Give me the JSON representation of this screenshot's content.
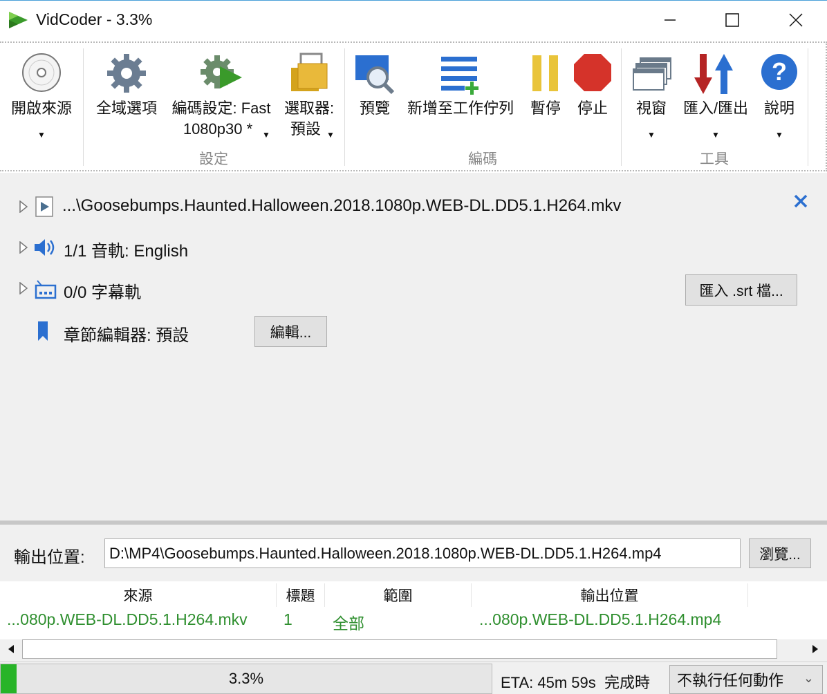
{
  "window": {
    "title": "VidCoder - 3.3%",
    "minimize_glyph": "—",
    "maximize_glyph": "☐",
    "close_glyph": "✕"
  },
  "ribbon": {
    "open_source": "開啟來源",
    "global_options": "全域選項",
    "encoding_settings_line1": "編碼設定: Fast",
    "encoding_settings_line2": "1080p30 *",
    "picker_line1": "選取器:",
    "picker_line2": "預設",
    "preview": "預覽",
    "add_to_queue": "新增至工作佇列",
    "pause": "暫停",
    "stop": "停止",
    "window_menu": "視窗",
    "import_export": "匯入/匯出",
    "help": "說明",
    "group_settings": "設定",
    "group_encoding": "編碼",
    "group_tools": "工具"
  },
  "source": {
    "file": "...\\Goosebumps.Haunted.Halloween.2018.1080p.WEB-DL.DD5.1.H264.mkv",
    "audio": "1/1 音軌: English",
    "subtitles": "0/0 字幕軌",
    "import_srt_button": "匯入 .srt 檔...",
    "chapters": "章節編輯器: 預設",
    "edit_button": "編輯..."
  },
  "output": {
    "label": "輸出位置:",
    "path": "D:\\MP4\\Goosebumps.Haunted.Halloween.2018.1080p.WEB-DL.DD5.1.H264.mp4",
    "browse_button": "瀏覽..."
  },
  "queue": {
    "columns": [
      "來源",
      "標題",
      "範圍",
      "輸出位置"
    ],
    "rows": [
      [
        "...080p.WEB-DL.DD5.1.H264.mkv",
        "1",
        "全部",
        "...080p.WEB-DL.DD5.1.H264.mp4"
      ]
    ]
  },
  "status": {
    "progress_percent": 3.3,
    "progress_text": "3.3%",
    "eta": "ETA: 45m 59s",
    "on_complete_label": "完成時",
    "on_complete_value": "不執行任何動作"
  },
  "colors": {
    "accent_green": "#28b428",
    "queue_text": "#2f8f2f",
    "close_blue": "#2b6fd0"
  }
}
